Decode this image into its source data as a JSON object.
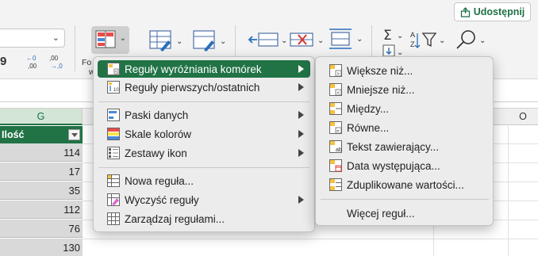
{
  "ribbon": {
    "share_label": "Udostępnij",
    "font_dropdown_value": "",
    "format_label_partial": "Fo",
    "format_label_partial2": "w",
    "decimal_increase": "←0\n,00",
    "decimal_decrease": ",00\n→,0",
    "currency_partial": "9",
    "icons": [
      "conditional-format-icon",
      "format-as-table-icon",
      "cell-styles-icon",
      "insert-icon",
      "delete-icon",
      "format-icon",
      "sum-icon",
      "sort-filter-icon",
      "find-icon"
    ]
  },
  "grid": {
    "column_g": "G",
    "column_o": "O",
    "header_cell": "Ilość",
    "values": [
      "114",
      "17",
      "35",
      "112",
      "76",
      "130"
    ]
  },
  "main_menu": {
    "items": [
      {
        "label": "Reguły wyróżniania komórek",
        "icon": "highlight-rules-icon",
        "submenu": true,
        "active": true
      },
      {
        "label": "Reguły pierwszych/ostatnich",
        "icon": "top-bottom-rules-icon",
        "submenu": true,
        "active": false
      },
      {
        "label": "Paski danych",
        "icon": "data-bars-icon",
        "submenu": true,
        "active": false
      },
      {
        "label": "Skale kolorów",
        "icon": "color-scales-icon",
        "submenu": true,
        "active": false
      },
      {
        "label": "Zestawy ikon",
        "icon": "icon-sets-icon",
        "submenu": true,
        "active": false
      },
      {
        "label": "Nowa reguła...",
        "icon": "new-rule-icon",
        "submenu": false,
        "active": false
      },
      {
        "label": "Wyczyść reguły",
        "icon": "clear-rules-icon",
        "submenu": true,
        "active": false
      },
      {
        "label": "Zarządzaj regułami...",
        "icon": "manage-rules-icon",
        "submenu": false,
        "active": false
      }
    ]
  },
  "sub_menu": {
    "items": [
      {
        "label": "Większe niż...",
        "icon": "greater-than-icon"
      },
      {
        "label": "Mniejsze niż...",
        "icon": "less-than-icon"
      },
      {
        "label": "Między...",
        "icon": "between-icon"
      },
      {
        "label": "Równe...",
        "icon": "equal-to-icon"
      },
      {
        "label": "Tekst zawierający...",
        "icon": "text-contains-icon"
      },
      {
        "label": "Data występująca...",
        "icon": "date-occurring-icon"
      },
      {
        "label": "Zduplikowane wartości...",
        "icon": "duplicate-values-icon"
      },
      {
        "label": "Więcej reguł...",
        "icon": ""
      }
    ]
  },
  "colors": {
    "accent": "#217346",
    "menu_bg": "#ececec",
    "selected_cells": "#d9d9d9"
  }
}
